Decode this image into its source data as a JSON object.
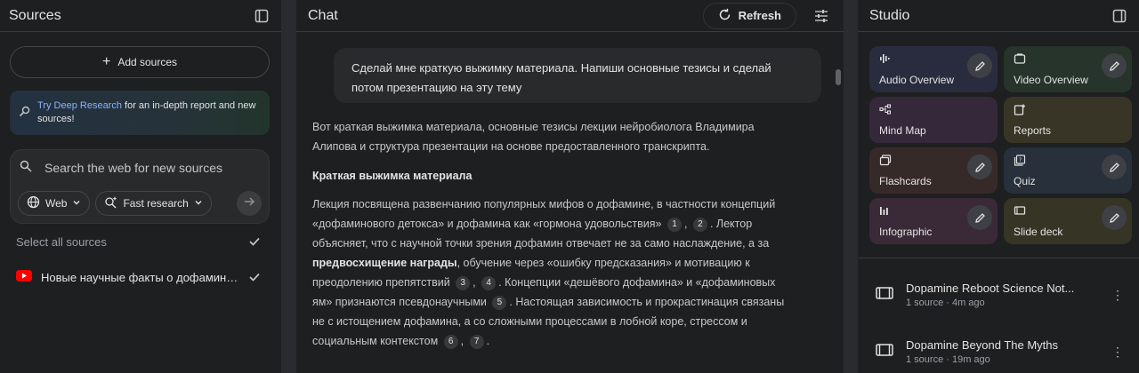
{
  "sources": {
    "title": "Sources",
    "add_label": "Add sources",
    "deep_research": {
      "link_text": "Try Deep Research",
      "rest_text": " for an in-depth report and new sources!"
    },
    "search": {
      "placeholder": "Search the web for new sources",
      "web_chip": "Web",
      "mode_chip": "Fast research"
    },
    "select_all_label": "Select all sources",
    "items": [
      {
        "title": "Новые научные факты о дофамине. ...",
        "icon": "youtube-icon",
        "checked": true
      }
    ]
  },
  "chat": {
    "title": "Chat",
    "refresh_label": "Refresh",
    "user_message": "Сделай мне краткую выжимку материала. Напиши основные тезисы и сделай потом презентацию на эту тему",
    "answer": {
      "intro": "Вот краткая выжимка материала, основные тезисы лекции нейробиолога Владимира Алипова и структура презентации на основе предоставленного транскрипта.",
      "heading": "Краткая выжимка материала",
      "p1": "Лекция посвящена развенчанию популярных мифов о дофамине, в частности концепций «дофаминового детокса» и дофамина как «гормона удовольствия»",
      "p2": ". Лектор объясняет, что с научной точки зрения дофамин отвечает не за само наслаждение, а за ",
      "p3_bold": "предвосхищение награды",
      "p4": ", обучение через «ошибку предсказания» и мотивацию к преодолению препятствий",
      "p5": ". Концепции «дешёвого дофамина» и «дофаминовых ям» признаются псевдонаучными",
      "p6": ". Настоящая зависимость и прокрастинация связаны не с истощением дофамина, а со сложными процессами в лобной коре, стрессом и социальным контекстом",
      "p7": ".",
      "citations": [
        "1",
        "2",
        "3",
        "4",
        "5",
        "6",
        "7"
      ]
    }
  },
  "studio": {
    "title": "Studio",
    "tiles": [
      {
        "label": "Audio Overview",
        "icon": "waveform-icon",
        "editable": true
      },
      {
        "label": "Video Overview",
        "icon": "video-icon",
        "editable": true
      },
      {
        "label": "Mind Map",
        "icon": "mindmap-icon",
        "editable": false
      },
      {
        "label": "Reports",
        "icon": "reports-icon",
        "editable": false
      },
      {
        "label": "Flashcards",
        "icon": "flashcards-icon",
        "editable": true
      },
      {
        "label": "Quiz",
        "icon": "quiz-icon",
        "editable": true
      },
      {
        "label": "Infographic",
        "icon": "infographic-icon",
        "editable": true
      },
      {
        "label": "Slide deck",
        "icon": "slides-icon",
        "editable": true
      }
    ],
    "notes": [
      {
        "title": "Dopamine Reboot Science Not...",
        "meta": "1 source · 4m ago"
      },
      {
        "title": "Dopamine Beyond The Myths",
        "meta": "1 source · 19m ago"
      }
    ]
  }
}
